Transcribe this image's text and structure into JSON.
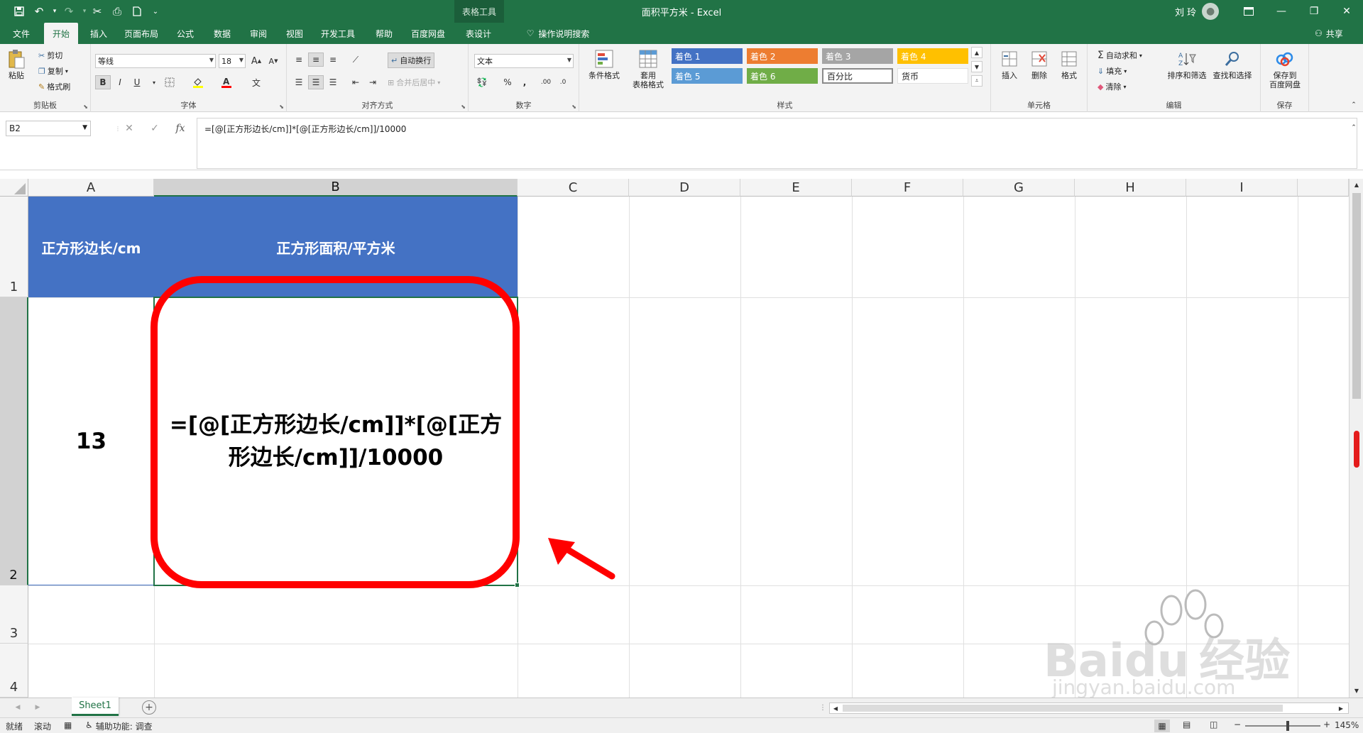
{
  "titlebar": {
    "context_tab_group": "表格工具",
    "doc_title": "面积平方米  -  Excel",
    "user_name": "刘 玲",
    "quick_access": [
      "save-icon",
      "undo-icon",
      "redo-icon",
      "cut-icon",
      "print-preview-icon",
      "new-icon",
      "customize-icon"
    ]
  },
  "tabs": [
    "文件",
    "开始",
    "插入",
    "页面布局",
    "公式",
    "数据",
    "审阅",
    "视图",
    "开发工具",
    "帮助",
    "百度网盘",
    "表设计"
  ],
  "active_tab": "开始",
  "tell_me": "操作说明搜索",
  "share": "共享",
  "ribbon": {
    "clipboard": {
      "paste": "粘贴",
      "cut": "剪切",
      "copy": "复制",
      "format_painter": "格式刷",
      "label": "剪贴板"
    },
    "font": {
      "name": "等线",
      "size": "18",
      "bold": "B",
      "italic": "I",
      "underline": "U",
      "label": "字体"
    },
    "alignment": {
      "wrap_text": "自动换行",
      "merge_center": "合并后居中",
      "label": "对齐方式"
    },
    "number": {
      "format": "文本",
      "percent": "%",
      "comma": ",",
      "label": "数字"
    },
    "styles": {
      "conditional": "条件格式",
      "table_format": "套用\n表格格式",
      "cells": [
        {
          "text": "着色 1",
          "bg": "#4472c4"
        },
        {
          "text": "着色 2",
          "bg": "#ed7d31"
        },
        {
          "text": "着色 3",
          "bg": "#a5a5a5"
        },
        {
          "text": "着色 4",
          "bg": "#ffc000"
        },
        {
          "text": "着色 5",
          "bg": "#5b9bd5"
        },
        {
          "text": "着色 6",
          "bg": "#70ad47"
        },
        {
          "text": "百分比",
          "bg": "#ffffff"
        },
        {
          "text": "货币",
          "bg": "#ffffff"
        }
      ],
      "label": "样式"
    },
    "cells_group": {
      "insert": "插入",
      "delete": "删除",
      "format": "格式",
      "label": "单元格"
    },
    "editing": {
      "autosum": "自动求和",
      "fill": "填充",
      "clear": "清除",
      "sort_filter": "排序和筛选",
      "find_select": "查找和选择",
      "label": "编辑"
    },
    "save": {
      "save_to": "保存到\n百度网盘",
      "label": "保存"
    }
  },
  "formula_bar": {
    "name_box": "B2",
    "cancel": "✕",
    "enter": "✓",
    "fx": "fx",
    "formula": "=[@[正方形边长/cm]]*[@[正方形边长/cm]]/10000"
  },
  "sheet": {
    "columns": [
      "A",
      "B",
      "C",
      "D",
      "E",
      "F",
      "G",
      "H",
      "I"
    ],
    "rows": [
      "1",
      "2",
      "3",
      "4"
    ],
    "selected_cell": "B2",
    "cells": {
      "A1": "正方形边长/cm",
      "B1": "正方形面积/平方米",
      "A2": "13",
      "B2": "=[@[正方形边长/cm]]*[@[正方形边长/cm]]/10000"
    },
    "header_fill": "#4472c4"
  },
  "sheet_tabs": {
    "active": "Sheet1",
    "add": "+"
  },
  "status": {
    "ready": "就绪",
    "scroll": "滚动",
    "accessibility": "辅助功能: 调查",
    "zoom": "145%"
  },
  "watermark": {
    "brand": "Baidu",
    "product": "经验",
    "url": "jingyan.baidu.com"
  }
}
